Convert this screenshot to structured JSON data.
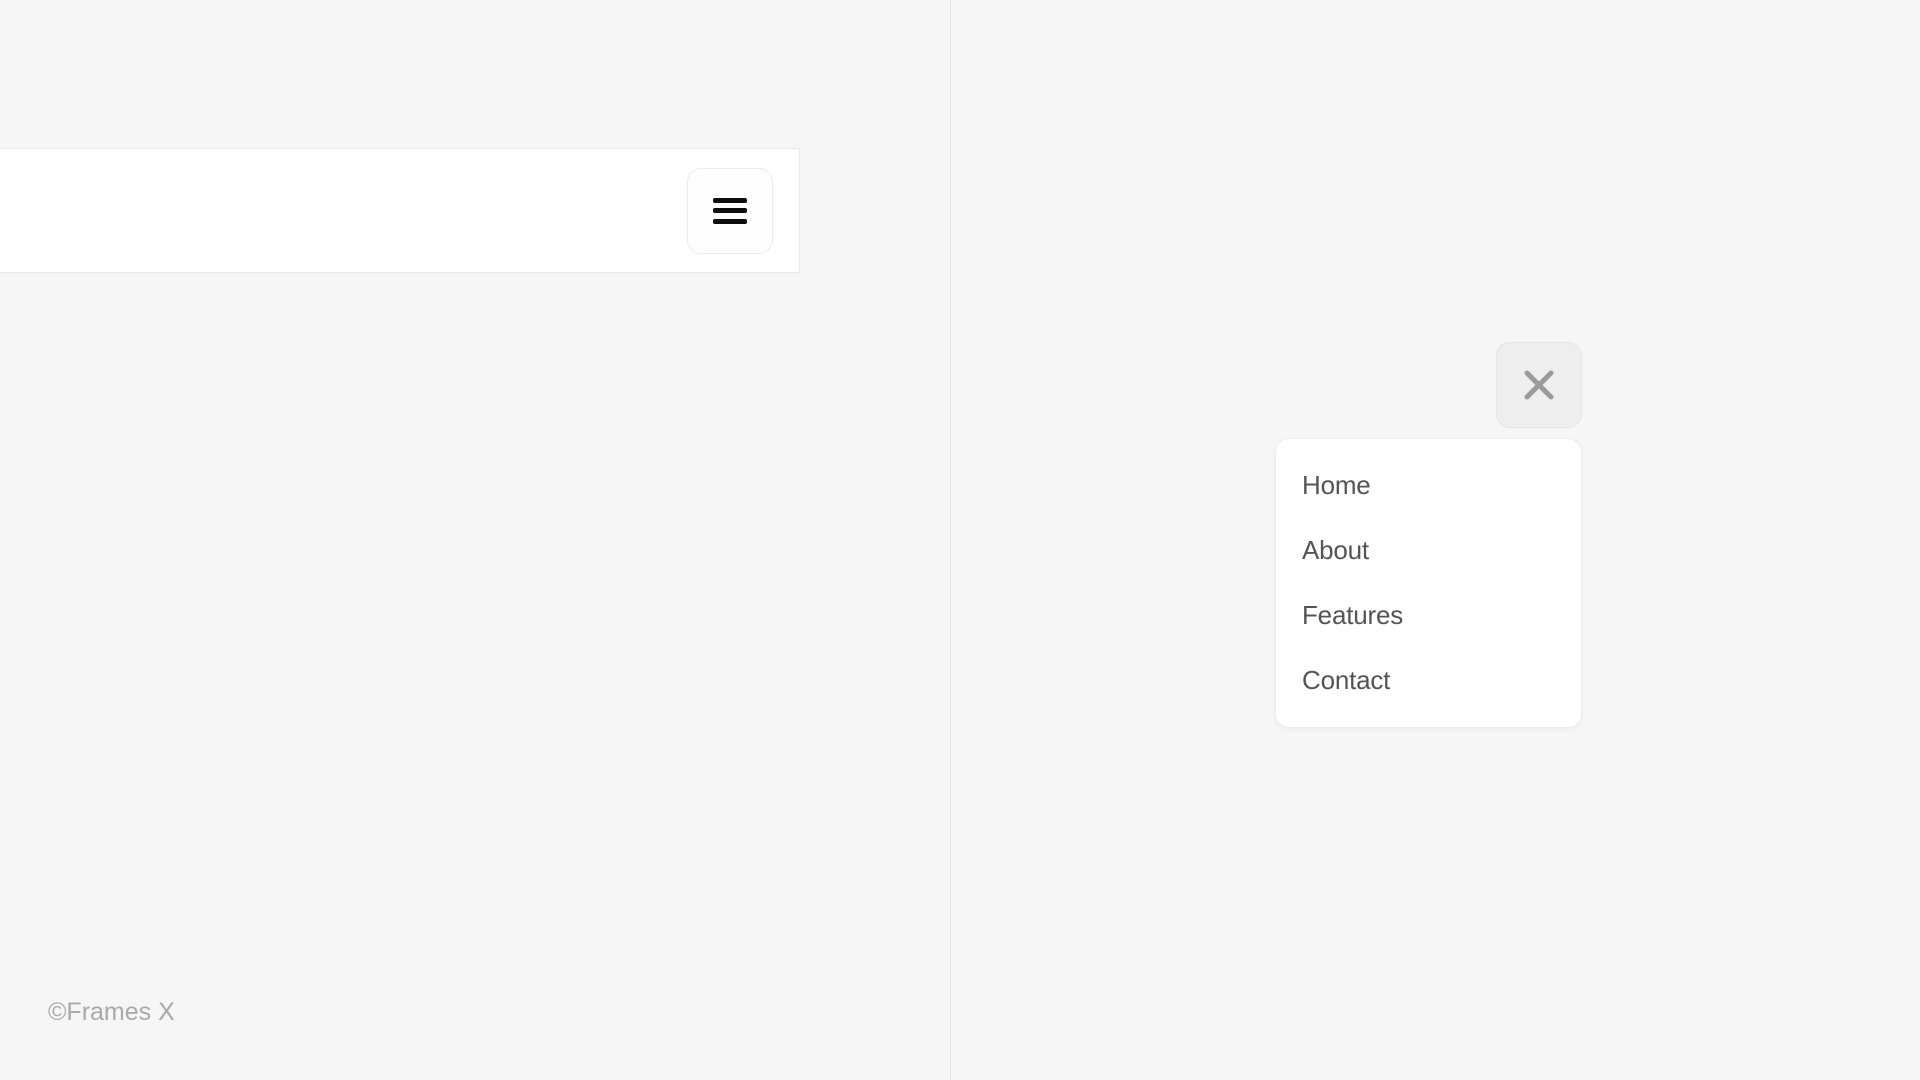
{
  "menu": {
    "items": [
      {
        "label": "Home"
      },
      {
        "label": "About"
      },
      {
        "label": "Features"
      },
      {
        "label": "Contact"
      }
    ]
  },
  "footer": {
    "text": "©Frames X"
  }
}
